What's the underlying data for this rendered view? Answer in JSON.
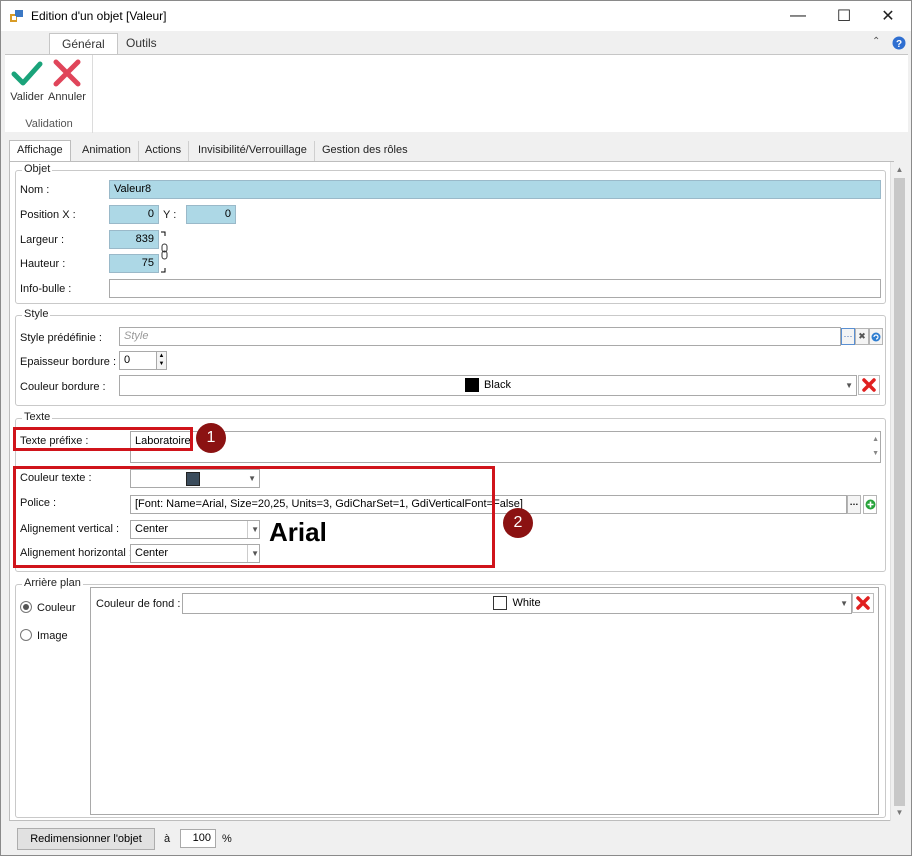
{
  "window": {
    "title": "Edition d'un objet [Valeur]",
    "controls": {
      "minimize": "—",
      "maximize": "☐",
      "close": "✕"
    }
  },
  "ribbon": {
    "tabs": [
      "Général",
      "Outils"
    ],
    "group_label": "Validation",
    "buttons": {
      "validate": "Valider",
      "cancel": "Annuler"
    }
  },
  "content_tabs": [
    "Affichage",
    "Animation",
    "Actions",
    "Invisibilité/Verrouillage",
    "Gestion des rôles"
  ],
  "objet": {
    "legend": "Objet",
    "name_label": "Nom :",
    "name_value": "Valeur8",
    "posx_label": "Position X :",
    "posx_value": "0",
    "posy_label": "Y :",
    "posy_value": "0",
    "width_label": "Largeur :",
    "width_value": "839",
    "height_label": "Hauteur :",
    "height_value": "75",
    "tooltip_label": "Info-bulle :",
    "tooltip_value": ""
  },
  "style": {
    "legend": "Style",
    "predefined_label": "Style prédéfinie :",
    "predefined_placeholder": "Style",
    "border_thickness_label": "Epaisseur bordure :",
    "border_thickness_value": "0",
    "border_color_label": "Couleur bordure :",
    "border_color_value": "Black",
    "border_color_hex": "#000000"
  },
  "texte": {
    "legend": "Texte",
    "prefix_label": "Texte préfixe :",
    "prefix_value": "Laboratoire",
    "text_color_label": "Couleur texte :",
    "text_color_hex": "#3b4c5c",
    "font_label": "Police :",
    "font_value": "[Font: Name=Arial, Size=20,25, Units=3, GdiCharSet=1, GdiVerticalFont=False]",
    "valign_label": "Alignement vertical :",
    "valign_value": "Center",
    "halign_label": "Alignement horizontal :",
    "halign_value": "Center",
    "font_preview": "Arial"
  },
  "annotations": {
    "badge1": "1",
    "badge2": "2"
  },
  "background": {
    "legend": "Arrière plan",
    "option_color": "Couleur",
    "option_image": "Image",
    "fill_color_label": "Couleur de fond :",
    "fill_color_value": "White",
    "fill_color_hex": "#ffffff"
  },
  "resize": {
    "button": "Redimensionner l'objet",
    "to_label": "à",
    "value": "100",
    "unit": "%"
  },
  "colors": {
    "highlight_red": "#d0141b",
    "badge": "#8b1212",
    "field_blue": "#add8e6"
  }
}
